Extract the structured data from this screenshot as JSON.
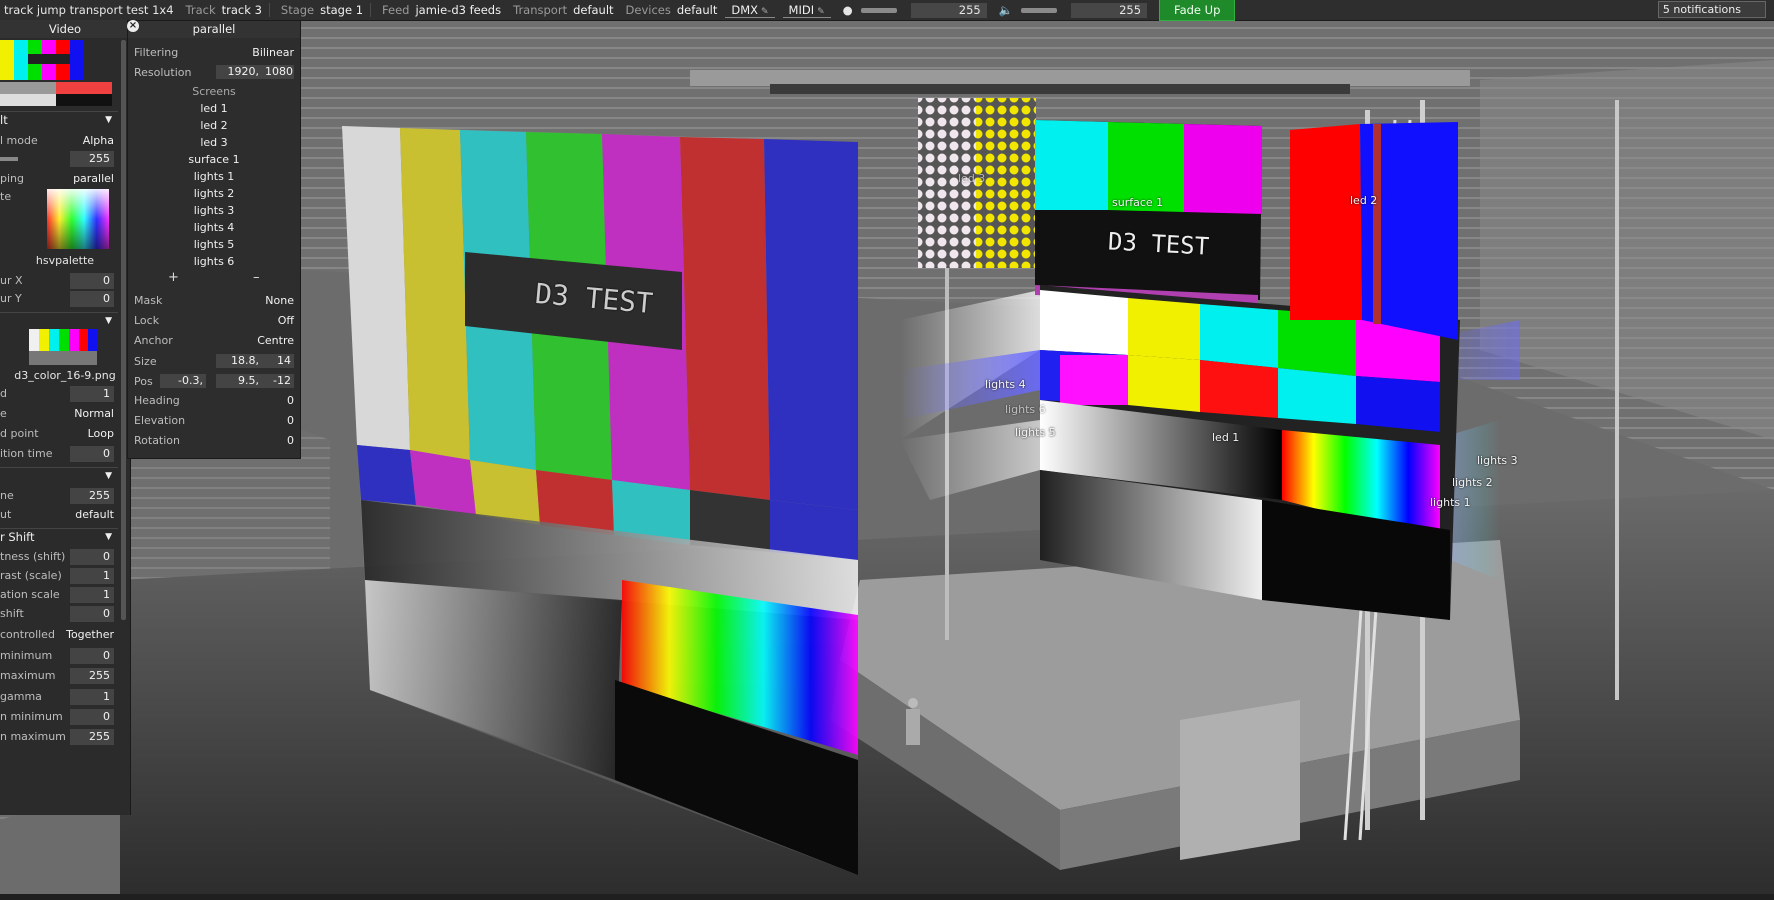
{
  "topbar": {
    "project": "track jump transport test 1x4",
    "track_label": "Track",
    "track_value": "track 3",
    "stage_label": "Stage",
    "stage_value": "stage 1",
    "feed_label": "Feed",
    "feed_value": "jamie-d3 feeds",
    "transport_label": "Transport",
    "transport_value": "default",
    "devices_label": "Devices",
    "devices_value": "default",
    "dmx": "DMX",
    "midi": "MIDI",
    "brightness_value": "255",
    "volume_value": "255",
    "fade_up": "Fade Up",
    "notifications": "5 notifications"
  },
  "left_panel": {
    "title": "Video",
    "rows": [
      {
        "key": "lt",
        "value": "",
        "section": true
      },
      {
        "key": "l mode",
        "value": "Alpha"
      },
      {
        "key": "",
        "value": "255",
        "box": true
      },
      {
        "key": "ping",
        "value": "parallel"
      },
      {
        "key": "te",
        "value": ""
      },
      {
        "key": "hsvpalette",
        "value": "",
        "center": true
      },
      {
        "key": "ur X",
        "value": "0",
        "box": true
      },
      {
        "key": "ur Y",
        "value": "0",
        "box": true
      },
      {
        "key": "d3_color_16-9.png",
        "value": "",
        "center": true
      },
      {
        "key": "d",
        "value": "1",
        "box": true
      },
      {
        "key": "e",
        "value": "Normal"
      },
      {
        "key": "d point",
        "value": "Loop"
      },
      {
        "key": "ition time",
        "value": "0",
        "box": true
      },
      {
        "key": "ne",
        "value": "255",
        "box": true
      },
      {
        "key": "ut",
        "value": "default"
      },
      {
        "key": "r Shift",
        "value": "",
        "section": true
      },
      {
        "key": "tness (shift)",
        "value": "0",
        "box": true
      },
      {
        "key": "rast (scale)",
        "value": "1",
        "box": true
      },
      {
        "key": "ation scale",
        "value": "1",
        "box": true
      },
      {
        "key": "shift",
        "value": "0",
        "box": true
      },
      {
        "key": "controlled",
        "value": "Together"
      },
      {
        "key": "minimum",
        "value": "0",
        "box": true
      },
      {
        "key": "maximum",
        "value": "255",
        "box": true
      },
      {
        "key": "gamma",
        "value": "1",
        "box": true
      },
      {
        "key": "n minimum",
        "value": "0",
        "box": true
      },
      {
        "key": "n maximum",
        "value": "255",
        "box": true
      }
    ]
  },
  "object_panel": {
    "title": "parallel",
    "filtering_label": "Filtering",
    "filtering_value": "Bilinear",
    "resolution_label": "Resolution",
    "res_w": "1920,",
    "res_h": "1080",
    "screens_label": "Screens",
    "screens": [
      "led 1",
      "led 2",
      "led 3",
      "surface 1",
      "lights 1",
      "lights 2",
      "lights 3",
      "lights 4",
      "lights 5",
      "lights 6"
    ],
    "plus": "+",
    "minus": "–",
    "mask_label": "Mask",
    "mask_value": "None",
    "lock_label": "Lock",
    "lock_value": "Off",
    "anchor_label": "Anchor",
    "anchor_value": "Centre",
    "size_label": "Size",
    "size_w": "18.8,",
    "size_h": "14",
    "pos_label": "Pos",
    "pos_x": "-0.3,",
    "pos_y": "9.5,",
    "pos_z": "-12",
    "heading_label": "Heading",
    "heading_value": "0",
    "elevation_label": "Elevation",
    "elevation_value": "0",
    "rotation_label": "Rotation",
    "rotation_value": "0"
  },
  "scene_labels": {
    "surface1": "surface 1",
    "led1": "led 1",
    "led2": "led 2",
    "led3": "led 3",
    "lights1": "lights 1",
    "lights2": "lights 2",
    "lights3": "lights 3",
    "lights4": "lights 4",
    "lights5": "lights 5",
    "lights6": "lights 6",
    "test_text": "D3 TEST",
    "test_text_2": "D3 TEST"
  },
  "colors": {
    "fade_green": "#1e8a2a",
    "bars": [
      "#d0d0d0",
      "#c8c030",
      "#30c0c0",
      "#30c030",
      "#c030c0",
      "#c03030",
      "#3030c0"
    ]
  }
}
